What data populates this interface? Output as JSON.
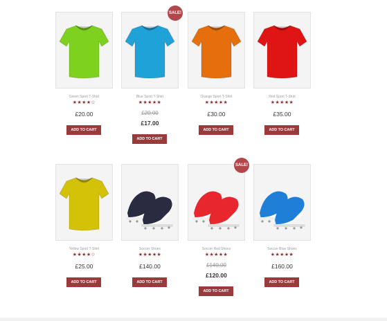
{
  "products": [
    {
      "title": "Green Sport T-Shirt",
      "stars": "★★★★☆",
      "price": "£20.00",
      "old_price": "",
      "sale": "",
      "button": "ADD TO CART",
      "color": "#7ed11e",
      "image": "tshirt-image"
    },
    {
      "title": "Blue Sport T-Shirt",
      "stars": "★★★★★",
      "price": "£17.00",
      "old_price": "£20.00",
      "sale": "SALE!",
      "button": "ADD TO CART",
      "color": "#1fa2d7",
      "image": "tshirt-image"
    },
    {
      "title": "Orange Sport T-Shirt",
      "stars": "★★★★★",
      "price": "£30.00",
      "old_price": "",
      "sale": "",
      "button": "ADD TO CART",
      "color": "#e56f0c",
      "image": "tshirt-image"
    },
    {
      "title": "Red Sport T-Shirt",
      "stars": "★★★★★",
      "price": "£35.00",
      "old_price": "",
      "sale": "",
      "button": "ADD TO CART",
      "color": "#df1414",
      "image": "tshirt-image"
    },
    {
      "title": "Yellow Sport T-Shirt",
      "stars": "★★★★☆",
      "price": "£25.00",
      "old_price": "",
      "sale": "",
      "button": "ADD TO CART",
      "color": "#d3c207",
      "image": "tshirt-image"
    },
    {
      "title": "Soccer Shoes",
      "stars": "★★★★★",
      "price": "£140.00",
      "old_price": "",
      "sale": "",
      "button": "ADD TO CART",
      "color": "#2a2a40",
      "image": "cleats-image"
    },
    {
      "title": "Soccer Red Shoes",
      "stars": "★★★★★",
      "price": "£120.00",
      "old_price": "£140.00",
      "sale": "SALE!",
      "button": "ADD TO CART",
      "color": "#e8262d",
      "image": "cleats-image"
    },
    {
      "title": "Soccer Blue Shoes",
      "stars": "★★★★★",
      "price": "£160.00",
      "old_price": "",
      "sale": "",
      "button": "ADD TO CART",
      "color": "#1f7fd8",
      "image": "cleats-image"
    }
  ],
  "colors": {
    "accent": "#9b3a3d",
    "sale_badge": "#b1464b",
    "star": "#8f2f30"
  }
}
